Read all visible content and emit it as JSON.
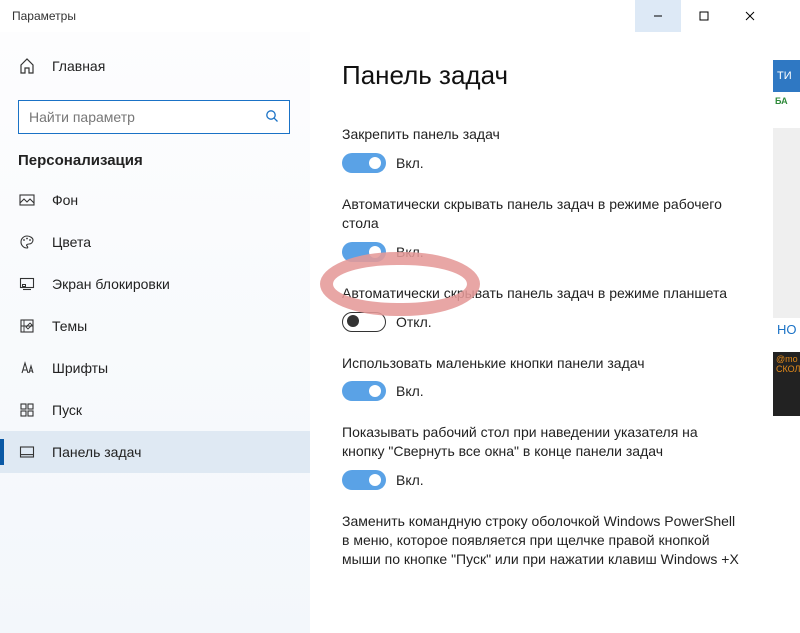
{
  "window": {
    "title": "Параметры"
  },
  "sidebar": {
    "home_label": "Главная",
    "search_placeholder": "Найти параметр",
    "section": "Персонализация",
    "items": [
      {
        "label": "Фон"
      },
      {
        "label": "Цвета"
      },
      {
        "label": "Экран блокировки"
      },
      {
        "label": "Темы"
      },
      {
        "label": "Шрифты"
      },
      {
        "label": "Пуск"
      },
      {
        "label": "Панель задач"
      }
    ]
  },
  "content": {
    "heading": "Панель задач",
    "settings": [
      {
        "title": "Закрепить панель задач",
        "state": "on",
        "state_label": "Вкл."
      },
      {
        "title": "Автоматически скрывать панель задач в режиме рабочего стола",
        "state": "on",
        "state_label": "Вкл."
      },
      {
        "title": "Автоматически скрывать панель задач в режиме планшета",
        "state": "off",
        "state_label": "Откл."
      },
      {
        "title": "Использовать маленькие кнопки панели задач",
        "state": "on",
        "state_label": "Вкл."
      },
      {
        "title": "Показывать рабочий стол при наведении указателя на кнопку \"Свернуть все окна\" в конце панели задач",
        "state": "on",
        "state_label": "Вкл."
      },
      {
        "title": "Заменить командную строку оболочкой Windows PowerShell в меню, которое появляется при щелчке правой кнопкой мыши по кнопке \"Пуск\" или при нажатии клавиш Windows +X",
        "state": "",
        "state_label": ""
      }
    ]
  },
  "rstrip": {
    "t1": "ТИ",
    "t2": "БА",
    "t3": "НО",
    "t4": "@mo СКОЛ"
  }
}
